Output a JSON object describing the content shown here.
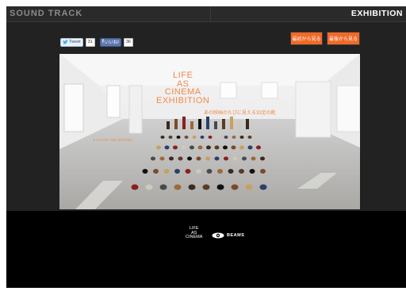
{
  "nav": {
    "left": "SOUND TRACK",
    "right": "EXHIBITION"
  },
  "social": {
    "tweet_label": "Tweet",
    "tweet_count": "31",
    "fb_label": "いいね!",
    "fb_count": "36"
  },
  "buttons": {
    "first": "最初から見る",
    "second": "最後から見る"
  },
  "hero": {
    "title_lines": [
      "LIFE",
      "AS",
      "CINEMA",
      "EXHIBITION"
    ],
    "subtitle": "あの映画のたびに見える33足の靴",
    "side_link": "▸ CLOSE THE SCREEN"
  },
  "footer": {
    "lac_lines": [
      "LIFE",
      "AS",
      "CINEMA"
    ],
    "beams_label": "BEAMS"
  },
  "colors": {
    "accent": "#f06a28",
    "frame": "#000000",
    "panel": "#222222"
  }
}
